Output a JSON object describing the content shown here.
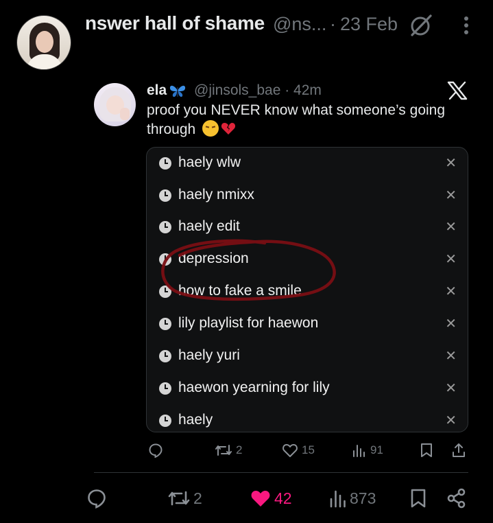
{
  "outer_tweet": {
    "display_name": "nswer hall of shame",
    "handle": "@ns...",
    "separator": "·",
    "date": "23 Feb",
    "actions": {
      "replies": "",
      "retweets": "2",
      "likes": "42",
      "views": "873"
    }
  },
  "quoted_tweet": {
    "display_name": "ela",
    "name_emoji": "blue-butterfly-icon",
    "handle_time": "@jinsols_bae · 42m",
    "text": "proof you NEVER know what someone’s going through",
    "emojis": [
      "pensive-face-emoji",
      "broken-heart-emoji"
    ],
    "search_history": [
      {
        "query": "haely wlw"
      },
      {
        "query": "haely nmixx"
      },
      {
        "query": "haely edit"
      },
      {
        "query": "depression"
      },
      {
        "query": "how to fake a smile"
      },
      {
        "query": "lily playlist for haewon"
      },
      {
        "query": "haely yuri"
      },
      {
        "query": "haewon yearning for lily"
      },
      {
        "query": "haely"
      }
    ],
    "remove_glyph": "✕",
    "actions": {
      "retweets": "2",
      "likes": "15",
      "views": "91"
    }
  },
  "colors": {
    "background": "#000000",
    "muted_text": "#71767b",
    "like_pink": "#f91880",
    "annotation_red": "#7a0f14"
  }
}
